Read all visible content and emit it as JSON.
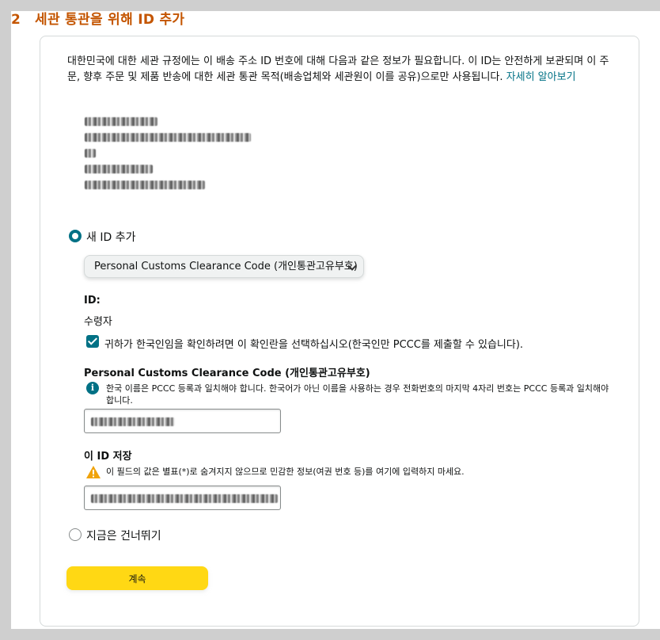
{
  "step": {
    "number": "2",
    "title": "세관 통관을 위해 ID 추가"
  },
  "intro": {
    "text": "대한민국에 대한 세관 규정에는 이 배송 주소 ID 번호에 대해 다음과 같은 정보가 필요합니다. 이 ID는 안전하게 보관되며 이 주문, 향후 주문 및 제품 반송에 대한 세관 통관 목적(배송업체와 세관원이 이를 공유)으로만 사용됩니다.",
    "learn_more": "자세히 알아보기"
  },
  "options": {
    "add_new_id": "새 ID 추가",
    "skip": "지금은 건너뛰기"
  },
  "id_type_select": {
    "selected": "Personal Customs Clearance Code (개인통관고유부호)"
  },
  "form": {
    "id_label": "ID:",
    "recipient_label": "수령자",
    "korean_checkbox": "귀하가 한국인임을 확인하려면 이 확인란을 선택하십시오(한국인만 PCCC를 제출할 수 있습니다).",
    "pccc_label": "Personal Customs Clearance Code (개인통관고유부호)",
    "pccc_info": "한국 이름은 PCCC 등록과 일치해야 합니다. 한국어가 아닌 이름을 사용하는 경우 전화번호의 마지막 4자리 번호는 PCCC 등록과 일치해야 합니다.",
    "save_label": "이 ID 저장",
    "save_warning": "이 필드의 값은 별표(*)로 숨겨지지 않으므로 민감한 정보(여권 번호 등)를 여기에 입력하지 마세요."
  },
  "continue_button": "계속",
  "colors": {
    "step_title": "#c45500",
    "accent": "#007185",
    "button": "#ffd814",
    "warning": "#f0a30a"
  }
}
